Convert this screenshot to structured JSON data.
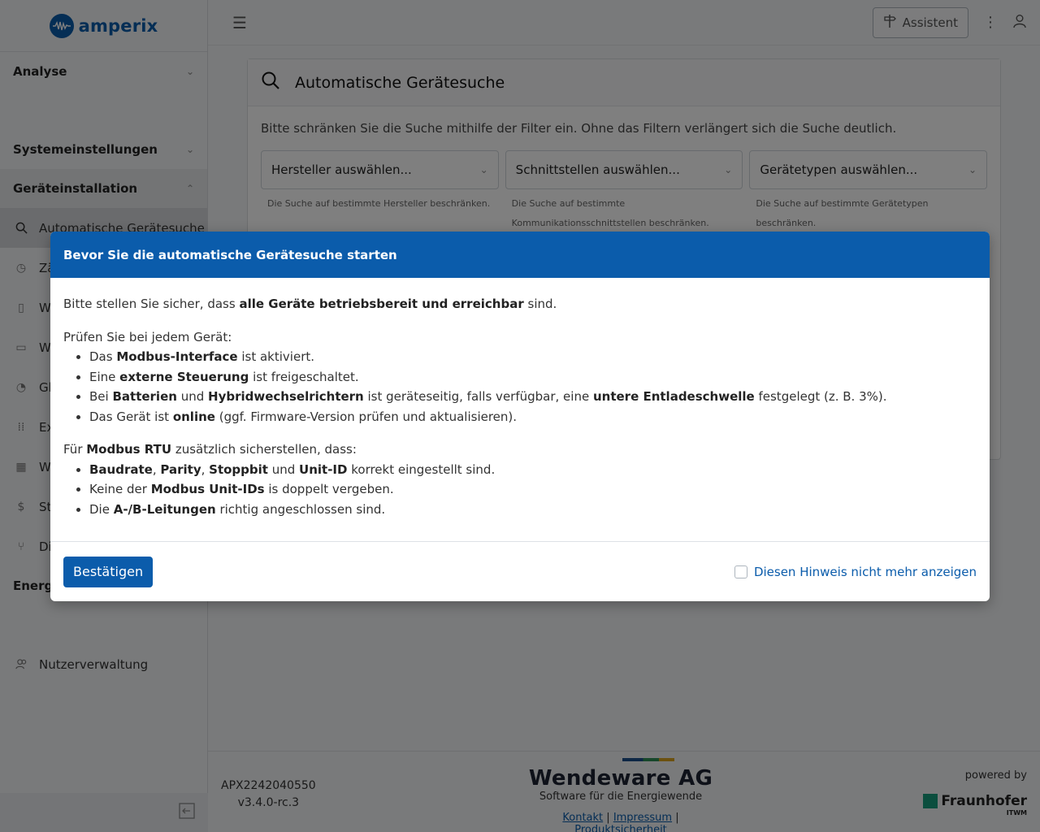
{
  "app": {
    "logo_text": "amperix"
  },
  "sidebar": {
    "groups": [
      {
        "label": "Analyse"
      },
      {
        "label": "Systemeinstellungen"
      },
      {
        "label": "Geräteinstallation"
      },
      {
        "label": "Energi"
      }
    ],
    "items": [
      {
        "label": "Automatische Gerätesuche",
        "icon": "search-icon"
      },
      {
        "label": "Zä",
        "icon": "clock-icon"
      },
      {
        "label": "W",
        "icon": "plug-icon"
      },
      {
        "label": "W",
        "icon": "meter-icon"
      },
      {
        "label": "Gl",
        "icon": "gauge-icon"
      },
      {
        "label": "Ex",
        "icon": "dots-icon"
      },
      {
        "label": "W",
        "icon": "grid-icon"
      },
      {
        "label": "St",
        "icon": "dollar-icon"
      },
      {
        "label": "Di",
        "icon": "branch-icon"
      },
      {
        "label": "Nutzerverwaltung",
        "icon": "users-icon"
      }
    ]
  },
  "topbar": {
    "assistant_label": "Assistent"
  },
  "card": {
    "title": "Automatische Gerätesuche",
    "hint": "Bitte schränken Sie die Suche mithilfe der Filter ein. Ohne das Filtern verlängert sich die Suche deutlich.",
    "filters": [
      {
        "placeholder": "Hersteller auswählen...",
        "help": "Die Suche auf bestimmte Hersteller beschränken."
      },
      {
        "placeholder": "Schnittstellen auswählen...",
        "help": "Die Suche auf bestimmte Kommunikationsschnittstellen beschränken."
      },
      {
        "placeholder": "Gerätetypen auswählen...",
        "help": "Die Suche auf bestimmte Gerätetypen beschränken."
      }
    ]
  },
  "modal": {
    "title": "Bevor Sie die automatische Gerätesuche starten",
    "intro_pre": "Bitte stellen Sie sicher, dass ",
    "intro_bold": "alle Geräte betriebsbereit und erreichbar",
    "intro_post": " sind.",
    "section1_title": "Prüfen Sie bei jedem Gerät:",
    "s1": {
      "i1_a": "Das ",
      "i1_b": "Modbus-Interface",
      "i1_c": " ist aktiviert.",
      "i2_a": "Eine ",
      "i2_b": "externe Steuerung",
      "i2_c": " ist freigeschaltet.",
      "i3_a": "Bei ",
      "i3_b": "Batterien",
      "i3_c": " und ",
      "i3_d": "Hybridwechselrichtern",
      "i3_e": " ist geräteseitig, falls verfügbar, eine ",
      "i3_f": "untere Entladeschwelle",
      "i3_g": " festgelegt (z. B. 3%).",
      "i4_a": "Das Gerät ist ",
      "i4_b": "online",
      "i4_c": " (ggf. Firmware-Version prüfen und aktualisieren)."
    },
    "section2_pre": "Für ",
    "section2_bold": "Modbus RTU",
    "section2_post": " zusätzlich sicherstellen, dass:",
    "s2": {
      "i1_a": "Baudrate",
      "i1_b": ", ",
      "i1_c": "Parity",
      "i1_d": ", ",
      "i1_e": "Stoppbit",
      "i1_f": " und ",
      "i1_g": "Unit-ID",
      "i1_h": " korrekt eingestellt sind.",
      "i2_a": "Keine der ",
      "i2_b": "Modbus Unit-IDs",
      "i2_c": " is doppelt vergeben.",
      "i3_a": "Die ",
      "i3_b": "A-/B-Leitungen",
      "i3_c": " richtig angeschlossen sind."
    },
    "confirm_label": "Bestätigen",
    "dont_show_label": "Diesen Hinweis nicht mehr anzeigen"
  },
  "footer": {
    "serial": "APX2242040550",
    "version": "v3.4.0-rc.3",
    "company": "Wendeware AG",
    "tagline": "Software für die Energiewende",
    "link_contact": "Kontakt",
    "link_imprint": "Impressum",
    "link_safety": "Produktsicherheit",
    "sep": "|",
    "powered_by": "powered by",
    "partner": "Fraunhofer",
    "partner_sub": "ITWM"
  }
}
